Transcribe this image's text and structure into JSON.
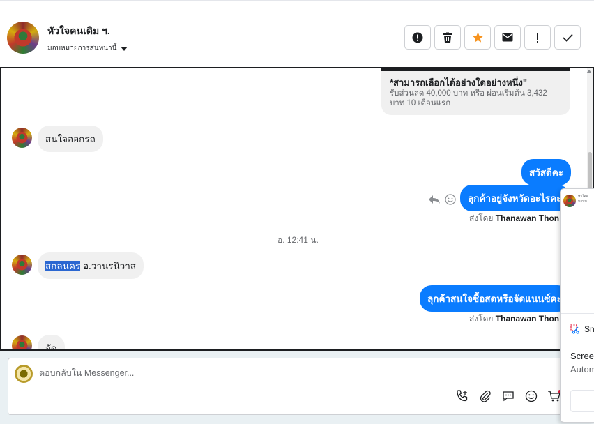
{
  "contact": {
    "name": "หัวใจคนเดิม ฯ.",
    "assign_label": "มอบหมายการสนทนานี้"
  },
  "header_actions": [
    {
      "icon": "alert-circle-icon"
    },
    {
      "icon": "trash-icon"
    },
    {
      "icon": "star-icon"
    },
    {
      "icon": "envelope-icon"
    },
    {
      "icon": "exclamation-icon"
    },
    {
      "icon": "check-icon"
    }
  ],
  "product_card": {
    "title": "*สามารถเลือกได้อย่างใดอย่างหนึ่ง\"",
    "body": "รับส่วนลด 40,000 บาท หรือ ผ่อนเริ่มต้น 3,432 บาท 10 เดือนแรก"
  },
  "messages": {
    "m1": "สนใจออกรถ",
    "m2": "สวัสดีคะ",
    "m3": "ลุกค้าอยู่จังหวัดอะไรคะ",
    "sent_by_prefix": "ส่งโดย",
    "sent_by_name": "Thanawan Thon",
    "timestamp": "อ. 12:41 น.",
    "m4_highlight": "สกลนคร",
    "m4_rest": " อ.วานรนิวาส",
    "m5": "ลุกค้าสนใจซื้อสดหรือจัดแนนซ์คะ",
    "m6": "จัด"
  },
  "composer": {
    "placeholder": "ตอบกลับใน Messenger..."
  },
  "popup": {
    "tiny_line1": "หัวใจค",
    "tiny_line2": "มอบห",
    "snip_label": "Sn",
    "text1": "Scree",
    "text2": "Autom"
  },
  "colors": {
    "outgoing_bubble": "#0a7cff",
    "incoming_bubble": "#f0f0f0",
    "star": "#f7931e"
  }
}
